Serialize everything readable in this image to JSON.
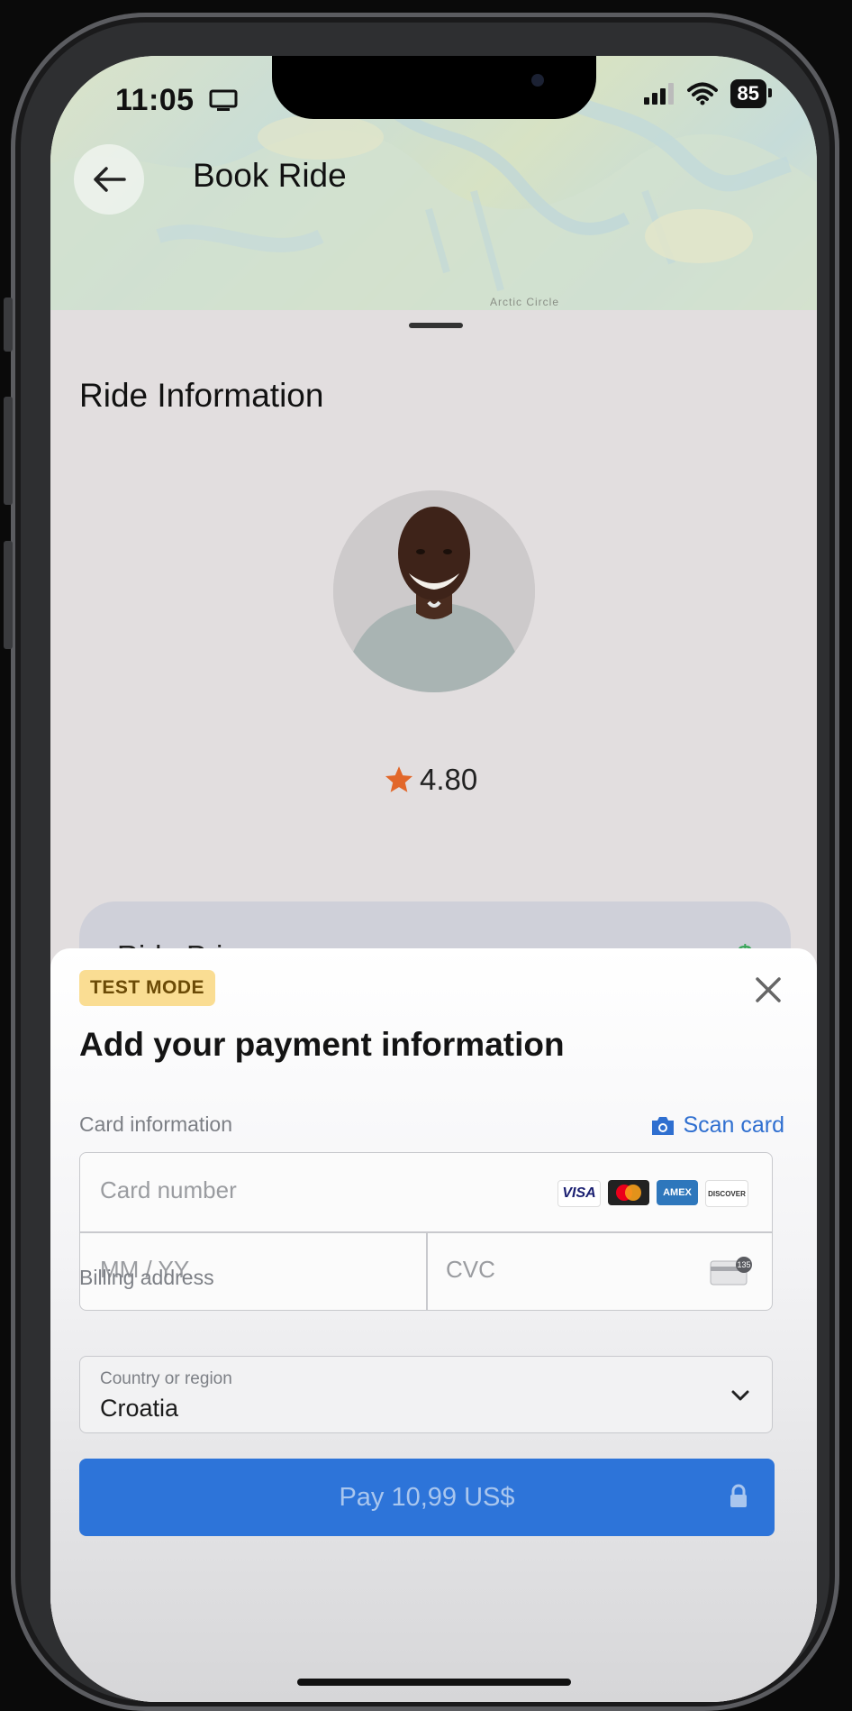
{
  "status_bar": {
    "time": "11:05",
    "battery": "85"
  },
  "header": {
    "title": "Book Ride",
    "map_label": "Arctic Circle"
  },
  "ride": {
    "section_title": "Ride Information",
    "rating": "4.80",
    "price_label": "Ride Price",
    "price_value": "$"
  },
  "payment": {
    "badge": "TEST MODE",
    "title": "Add your payment information",
    "card_info_label": "Card information",
    "scan_card": "Scan card",
    "card_number_placeholder": "Card number",
    "expiry_placeholder": "MM / YY",
    "cvc_placeholder": "CVC",
    "cvc_icon_text": "135",
    "brands": [
      "VISA",
      "AMEX",
      "DISCOVER"
    ],
    "billing_label": "Billing address",
    "country_label": "Country or region",
    "country_value": "Croatia",
    "pay_button": "Pay 10,99 US$"
  },
  "colors": {
    "accent_blue": "#2d74d9",
    "test_badge": "#fadd93",
    "star": "#e2672a",
    "price_green": "#3aa65a"
  }
}
